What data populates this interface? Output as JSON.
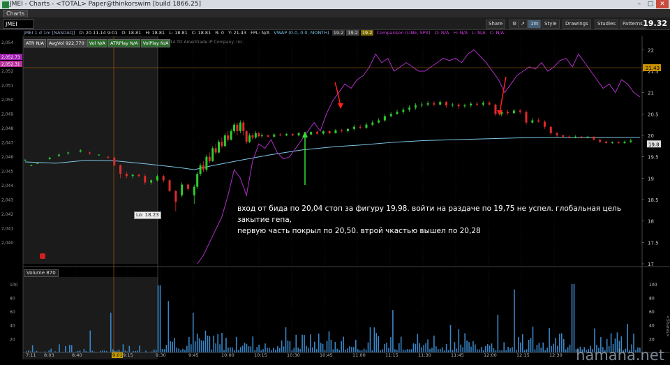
{
  "window": {
    "title": "JMEI - Charts - <TOTAL> Paper@thinkorswim [build 1866.25]",
    "controls": [
      "–",
      "□",
      "✕"
    ]
  },
  "tab": {
    "label": "Charts"
  },
  "toolbar": {
    "symbol": "JMEI",
    "share": "Share",
    "period": "1m",
    "style": "Style",
    "drawings": "Drawings",
    "studies": "Studies",
    "patterns": "Patterns",
    "last_price": "19.32"
  },
  "infobar": {
    "name": "JMEI 1 d 1m [NASDAQ]",
    "date": "D: 20.11.14 9:01",
    "open": "O: 18.81",
    "high": "H: 18.81",
    "low": "L: 18.81",
    "close": "C: 18.81",
    "r": "R: 0",
    "y": "Y: 21.43",
    "fpl": "FPL: N/A",
    "vwap": "VWAP (0.0, 0.0, MONTH)",
    "v1": "19.2",
    "v2": "19.2",
    "v3": "19.2",
    "comparison": "Comparison (LINE, SPX)",
    "c_o": "O: N/A",
    "c_h": "H: N/A",
    "c_l": "L: N/A",
    "c_c": "C: N/A"
  },
  "studies": [
    {
      "label": "ATR N/A",
      "green": false
    },
    {
      "label": "AvgVol 922,770",
      "green": false
    },
    {
      "label": "Vol N/A",
      "green": true
    },
    {
      "label": "ATRPlay N/A",
      "green": true
    },
    {
      "label": "VolPlay N/A",
      "green": true
    }
  ],
  "copyright": "©2014 TD Ameritrade IP Company, Inc.",
  "annotation": {
    "line1": "вход от бида по 20,04 стоп за фигуру 19,98. войти на раздаче по 19,75 не успел. глобальная цель закытие гепа,",
    "line2": "первую часть покрыл по 20,50. втрой чкастью вышел по 20,28"
  },
  "low_label": "Lo: 18.23",
  "volume_label": "Volume",
  "volume_value": "870",
  "left_axis": [
    "2,054",
    "2,053",
    "2,052",
    "2,051",
    "2,050",
    "2,049",
    "2,048",
    "2,047",
    "2,046",
    "2,045",
    "2,044",
    "2,043",
    "2,042",
    "2,041",
    "2,040"
  ],
  "left_axis_tags": [
    "2,052.73",
    "2,052.31"
  ],
  "right_axis": [
    "22",
    "21.5",
    "21",
    "20.5",
    "20",
    "19.5",
    "19",
    "18.5",
    "18",
    "17.5",
    "17"
  ],
  "right_tags": {
    "prev_close": "21.43",
    "current": "19.8"
  },
  "vol_axis_left": [
    "100",
    "80",
    "60",
    "40",
    "20"
  ],
  "vol_axis_right": [
    "100",
    "80",
    "60",
    "40",
    "20"
  ],
  "vol_axis_right_label": "<Shares>",
  "time_axis": [
    "7:11",
    "8:03",
    "8:40",
    "9:01",
    "9:15",
    "9:30",
    "9:45",
    "10:00",
    "10:15",
    "10:30",
    "10:45",
    "11:00",
    "11:15",
    "11:30",
    "11:45",
    "12:00",
    "12:15",
    "12:30"
  ],
  "highlighted_time": "9:01",
  "watermark": "hamaha.net",
  "colors": {
    "up": "#2ecc2e",
    "down": "#e02a2a",
    "vwap": "#7fc7e8",
    "comparison": "#b030c8",
    "volume": "#3a86c8",
    "arrow_red": "#ff2020",
    "arrow_green": "#30e030"
  },
  "chart_data": {
    "type": "candlestick",
    "price_range": [
      17,
      22.25
    ],
    "candles": [
      {
        "t": 0,
        "o": 19.42,
        "c": 19.42,
        "h": 19.45,
        "l": 19.4
      },
      {
        "t": 2,
        "o": 19.3,
        "c": 19.3,
        "h": 19.32,
        "l": 19.28
      },
      {
        "t": 4,
        "o": 19.35,
        "c": 19.35,
        "h": 19.37,
        "l": 19.33
      },
      {
        "t": 8,
        "o": 19.45,
        "c": 19.48,
        "h": 19.5,
        "l": 19.43
      },
      {
        "t": 11,
        "o": 19.52,
        "c": 19.55,
        "h": 19.58,
        "l": 19.5
      },
      {
        "t": 14,
        "o": 19.58,
        "c": 19.6,
        "h": 19.62,
        "l": 19.55
      },
      {
        "t": 18,
        "o": 19.62,
        "c": 19.65,
        "h": 19.68,
        "l": 19.6
      },
      {
        "t": 21,
        "o": 19.6,
        "c": 19.58,
        "h": 19.62,
        "l": 19.55
      },
      {
        "t": 24,
        "o": 19.55,
        "c": 19.55,
        "h": 19.56,
        "l": 19.53
      },
      {
        "t": 27,
        "o": 19.5,
        "c": 19.48,
        "h": 19.52,
        "l": 19.45
      },
      {
        "t": 29,
        "o": 19.48,
        "c": 19.3,
        "h": 19.5,
        "l": 19.28
      },
      {
        "t": 31,
        "o": 19.3,
        "c": 19.1,
        "h": 19.32,
        "l": 19.0
      },
      {
        "t": 33,
        "o": 19.1,
        "c": 19.05,
        "h": 19.15,
        "l": 19.0
      },
      {
        "t": 35,
        "o": 19.05,
        "c": 19.08,
        "h": 19.1,
        "l": 19.0
      },
      {
        "t": 37,
        "o": 19.08,
        "c": 19.05,
        "h": 19.1,
        "l": 19.02
      },
      {
        "t": 39,
        "o": 19.05,
        "c": 18.9,
        "h": 19.1,
        "l": 18.85
      },
      {
        "t": 41,
        "o": 18.9,
        "c": 18.95,
        "h": 18.98,
        "l": 18.85
      },
      {
        "t": 43,
        "o": 18.95,
        "c": 19.05,
        "h": 19.08,
        "l": 18.92
      },
      {
        "t": 45,
        "o": 19.05,
        "c": 18.95,
        "h": 19.08,
        "l": 18.9
      },
      {
        "t": 47,
        "o": 18.95,
        "c": 18.7,
        "h": 18.98,
        "l": 18.68
      },
      {
        "t": 49,
        "o": 18.7,
        "c": 18.45,
        "h": 18.72,
        "l": 18.23
      },
      {
        "t": 51,
        "o": 18.6,
        "c": 18.85,
        "h": 18.9,
        "l": 18.55
      },
      {
        "t": 53,
        "o": 18.85,
        "c": 18.75,
        "h": 18.88,
        "l": 18.7
      },
      {
        "t": 55,
        "o": 18.6,
        "c": 18.8,
        "h": 18.85,
        "l": 18.4
      },
      {
        "t": 56,
        "o": 18.8,
        "c": 19.1,
        "h": 19.15,
        "l": 18.75
      },
      {
        "t": 57,
        "o": 19.1,
        "c": 19.3,
        "h": 19.35,
        "l": 19.05
      },
      {
        "t": 58,
        "o": 19.3,
        "c": 19.2,
        "h": 19.4,
        "l": 19.15
      },
      {
        "t": 59,
        "o": 19.2,
        "c": 19.5,
        "h": 19.55,
        "l": 19.15
      },
      {
        "t": 60,
        "o": 19.5,
        "c": 19.4,
        "h": 19.6,
        "l": 19.35
      },
      {
        "t": 61,
        "o": 19.4,
        "c": 19.7,
        "h": 19.75,
        "l": 19.38
      },
      {
        "t": 62,
        "o": 19.7,
        "c": 19.6,
        "h": 19.8,
        "l": 19.55
      },
      {
        "t": 63,
        "o": 19.6,
        "c": 19.85,
        "h": 19.9,
        "l": 19.58
      },
      {
        "t": 64,
        "o": 19.85,
        "c": 19.75,
        "h": 19.95,
        "l": 19.7
      },
      {
        "t": 65,
        "o": 19.75,
        "c": 20.0,
        "h": 20.05,
        "l": 19.72
      },
      {
        "t": 66,
        "o": 20.0,
        "c": 19.9,
        "h": 20.1,
        "l": 19.85
      },
      {
        "t": 67,
        "o": 19.9,
        "c": 20.1,
        "h": 20.15,
        "l": 19.88
      },
      {
        "t": 68,
        "o": 20.1,
        "c": 20.25,
        "h": 20.3,
        "l": 20.05
      },
      {
        "t": 69,
        "o": 20.25,
        "c": 20.1,
        "h": 20.3,
        "l": 20.0
      },
      {
        "t": 70,
        "o": 20.1,
        "c": 20.3,
        "h": 20.35,
        "l": 20.05
      },
      {
        "t": 71,
        "o": 20.3,
        "c": 20.1,
        "h": 20.35,
        "l": 20.0
      },
      {
        "t": 72,
        "o": 20.1,
        "c": 19.85,
        "h": 20.12,
        "l": 19.8
      },
      {
        "t": 73,
        "o": 19.85,
        "c": 20.0,
        "h": 20.05,
        "l": 19.82
      },
      {
        "t": 74,
        "o": 20.0,
        "c": 19.95,
        "h": 20.05,
        "l": 19.9
      },
      {
        "t": 75,
        "o": 19.95,
        "c": 20.05,
        "h": 20.1,
        "l": 19.92
      },
      {
        "t": 76,
        "o": 20.05,
        "c": 19.98,
        "h": 20.08,
        "l": 19.95
      },
      {
        "t": 77,
        "o": 19.98,
        "c": 20.0,
        "h": 20.05,
        "l": 19.95
      },
      {
        "t": 79,
        "o": 20.0,
        "c": 19.97,
        "h": 20.02,
        "l": 19.95
      },
      {
        "t": 81,
        "o": 19.97,
        "c": 20.02,
        "h": 20.05,
        "l": 19.95
      },
      {
        "t": 83,
        "o": 20.02,
        "c": 20.0,
        "h": 20.05,
        "l": 19.98
      },
      {
        "t": 85,
        "o": 20.0,
        "c": 20.03,
        "h": 20.05,
        "l": 19.98
      },
      {
        "t": 87,
        "o": 20.03,
        "c": 20.0,
        "h": 20.06,
        "l": 19.98
      },
      {
        "t": 89,
        "o": 20.0,
        "c": 20.05,
        "h": 20.08,
        "l": 19.98
      },
      {
        "t": 91,
        "o": 20.05,
        "c": 20.02,
        "h": 20.08,
        "l": 20.0
      },
      {
        "t": 93,
        "o": 20.02,
        "c": 20.08,
        "h": 20.1,
        "l": 20.0
      },
      {
        "t": 95,
        "o": 20.08,
        "c": 20.04,
        "h": 20.12,
        "l": 20.02
      },
      {
        "t": 97,
        "o": 20.04,
        "c": 20.1,
        "h": 20.12,
        "l": 20.02
      },
      {
        "t": 99,
        "o": 20.1,
        "c": 20.05,
        "h": 20.12,
        "l": 20.02
      },
      {
        "t": 101,
        "o": 20.05,
        "c": 20.12,
        "h": 20.15,
        "l": 20.04
      },
      {
        "t": 103,
        "o": 20.12,
        "c": 20.1,
        "h": 20.15,
        "l": 20.06
      },
      {
        "t": 105,
        "o": 20.1,
        "c": 20.15,
        "h": 20.18,
        "l": 20.06
      },
      {
        "t": 107,
        "o": 20.15,
        "c": 20.2,
        "h": 20.25,
        "l": 20.12
      },
      {
        "t": 109,
        "o": 20.2,
        "c": 20.18,
        "h": 20.25,
        "l": 20.15
      },
      {
        "t": 111,
        "o": 20.18,
        "c": 20.25,
        "h": 20.3,
        "l": 20.15
      },
      {
        "t": 113,
        "o": 20.25,
        "c": 20.3,
        "h": 20.35,
        "l": 20.22
      },
      {
        "t": 115,
        "o": 20.3,
        "c": 20.35,
        "h": 20.4,
        "l": 20.28
      },
      {
        "t": 117,
        "o": 20.35,
        "c": 20.45,
        "h": 20.5,
        "l": 20.32
      },
      {
        "t": 119,
        "o": 20.45,
        "c": 20.5,
        "h": 20.55,
        "l": 20.42
      },
      {
        "t": 121,
        "o": 20.5,
        "c": 20.55,
        "h": 20.6,
        "l": 20.48
      },
      {
        "t": 123,
        "o": 20.55,
        "c": 20.6,
        "h": 20.65,
        "l": 20.5
      },
      {
        "t": 125,
        "o": 20.6,
        "c": 20.65,
        "h": 20.7,
        "l": 20.55
      },
      {
        "t": 127,
        "o": 20.65,
        "c": 20.7,
        "h": 20.75,
        "l": 20.6
      },
      {
        "t": 129,
        "o": 20.7,
        "c": 20.72,
        "h": 20.78,
        "l": 20.65
      },
      {
        "t": 131,
        "o": 20.72,
        "c": 20.75,
        "h": 20.8,
        "l": 20.68
      },
      {
        "t": 133,
        "o": 20.75,
        "c": 20.72,
        "h": 20.8,
        "l": 20.68
      },
      {
        "t": 135,
        "o": 20.72,
        "c": 20.78,
        "h": 20.82,
        "l": 20.7
      },
      {
        "t": 137,
        "o": 20.78,
        "c": 20.7,
        "h": 20.8,
        "l": 20.65
      },
      {
        "t": 139,
        "o": 20.7,
        "c": 20.72,
        "h": 20.76,
        "l": 20.66
      },
      {
        "t": 141,
        "o": 20.72,
        "c": 20.68,
        "h": 20.75,
        "l": 20.62
      },
      {
        "t": 143,
        "o": 20.68,
        "c": 20.7,
        "h": 20.74,
        "l": 20.64
      },
      {
        "t": 145,
        "o": 20.7,
        "c": 20.74,
        "h": 20.78,
        "l": 20.66
      },
      {
        "t": 147,
        "o": 20.74,
        "c": 20.72,
        "h": 20.78,
        "l": 20.68
      },
      {
        "t": 149,
        "o": 20.72,
        "c": 20.76,
        "h": 20.8,
        "l": 20.68
      },
      {
        "t": 151,
        "o": 20.76,
        "c": 20.72,
        "h": 20.8,
        "l": 20.7
      },
      {
        "t": 153,
        "o": 20.72,
        "c": 20.5,
        "h": 20.74,
        "l": 20.45
      },
      {
        "t": 155,
        "o": 20.5,
        "c": 20.55,
        "h": 20.6,
        "l": 20.45
      },
      {
        "t": 157,
        "o": 20.55,
        "c": 20.52,
        "h": 20.6,
        "l": 20.48
      },
      {
        "t": 159,
        "o": 20.52,
        "c": 20.58,
        "h": 20.62,
        "l": 20.5
      },
      {
        "t": 161,
        "o": 20.58,
        "c": 20.55,
        "h": 20.62,
        "l": 20.5
      },
      {
        "t": 163,
        "o": 20.55,
        "c": 20.3,
        "h": 20.58,
        "l": 20.25
      },
      {
        "t": 165,
        "o": 20.3,
        "c": 20.35,
        "h": 20.4,
        "l": 20.28
      },
      {
        "t": 167,
        "o": 20.35,
        "c": 20.32,
        "h": 20.4,
        "l": 20.3
      },
      {
        "t": 169,
        "o": 20.32,
        "c": 20.2,
        "h": 20.35,
        "l": 20.15
      },
      {
        "t": 171,
        "o": 20.2,
        "c": 20.05,
        "h": 20.22,
        "l": 20.0
      },
      {
        "t": 173,
        "o": 20.05,
        "c": 20.0,
        "h": 20.08,
        "l": 19.95
      },
      {
        "t": 175,
        "o": 20.0,
        "c": 19.97,
        "h": 20.02,
        "l": 19.95
      },
      {
        "t": 177,
        "o": 19.97,
        "c": 19.95,
        "h": 20.0,
        "l": 19.93
      },
      {
        "t": 179,
        "o": 19.95,
        "c": 19.97,
        "h": 20.0,
        "l": 19.93
      },
      {
        "t": 181,
        "o": 19.97,
        "c": 19.95,
        "h": 19.99,
        "l": 19.93
      },
      {
        "t": 183,
        "o": 19.95,
        "c": 19.97,
        "h": 19.99,
        "l": 19.93
      },
      {
        "t": 185,
        "o": 19.97,
        "c": 19.9,
        "h": 19.98,
        "l": 19.88
      },
      {
        "t": 187,
        "o": 19.9,
        "c": 19.85,
        "h": 19.92,
        "l": 19.82
      },
      {
        "t": 189,
        "o": 19.85,
        "c": 19.82,
        "h": 19.88,
        "l": 19.8
      },
      {
        "t": 191,
        "o": 19.82,
        "c": 19.84,
        "h": 19.86,
        "l": 19.8
      },
      {
        "t": 193,
        "o": 19.84,
        "c": 19.82,
        "h": 19.86,
        "l": 19.8
      },
      {
        "t": 195,
        "o": 19.82,
        "c": 19.85,
        "h": 19.88,
        "l": 19.8
      },
      {
        "t": 197,
        "o": 19.85,
        "c": 19.88,
        "h": 19.92,
        "l": 19.82
      }
    ]
  }
}
